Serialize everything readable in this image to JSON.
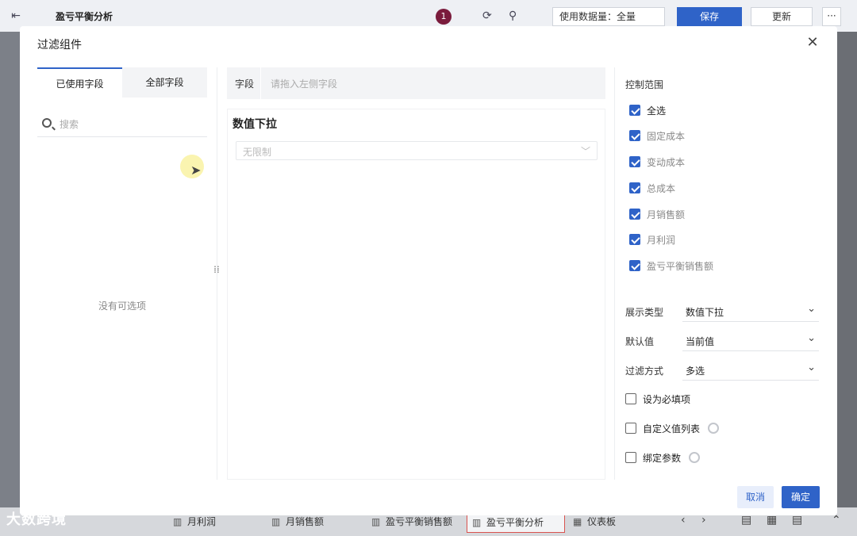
{
  "app": {
    "title": "盈亏平衡分析",
    "notification_count": "1",
    "data_usage": "使用数据量：全量",
    "save_label": "保存",
    "update_label": "更新",
    "more_label": "···"
  },
  "bottom_tabs": [
    {
      "label": "月利润"
    },
    {
      "label": "月销售额"
    },
    {
      "label": "盈亏平衡销售额"
    },
    {
      "label": "盈亏平衡分析"
    },
    {
      "label": "仪表板"
    }
  ],
  "watermark": "大数跨境",
  "dialog": {
    "title": "过滤组件",
    "close_icon": "close-icon",
    "tabs": {
      "used": "已使用字段",
      "all": "全部字段"
    },
    "search_placeholder": "搜索",
    "empty_text": "没有可选项",
    "field_label": "字段",
    "field_placeholder": "请拖入左侧字段",
    "preview": {
      "title": "数值下拉",
      "select_value": "无限制"
    },
    "control_range": {
      "title": "控制范围",
      "items": [
        {
          "label": "全选",
          "checked": true
        },
        {
          "label": "固定成本",
          "checked": true
        },
        {
          "label": "变动成本",
          "checked": true
        },
        {
          "label": "总成本",
          "checked": true
        },
        {
          "label": "月销售额",
          "checked": true
        },
        {
          "label": "月利润",
          "checked": true
        },
        {
          "label": "盈亏平衡销售额",
          "checked": true
        }
      ]
    },
    "settings": {
      "display_type": {
        "label": "展示类型",
        "value": "数值下拉"
      },
      "default_value": {
        "label": "默认值",
        "value": "当前值"
      },
      "filter_mode": {
        "label": "过滤方式",
        "value": "多选"
      }
    },
    "options": {
      "required": "设为必填项",
      "custom_list": "自定义值列表",
      "bind_param": "绑定参数"
    },
    "cancel_label": "取消",
    "ok_label": "确定"
  },
  "colors": {
    "accent": "#2f63c8",
    "badge": "#7a1b3c"
  }
}
